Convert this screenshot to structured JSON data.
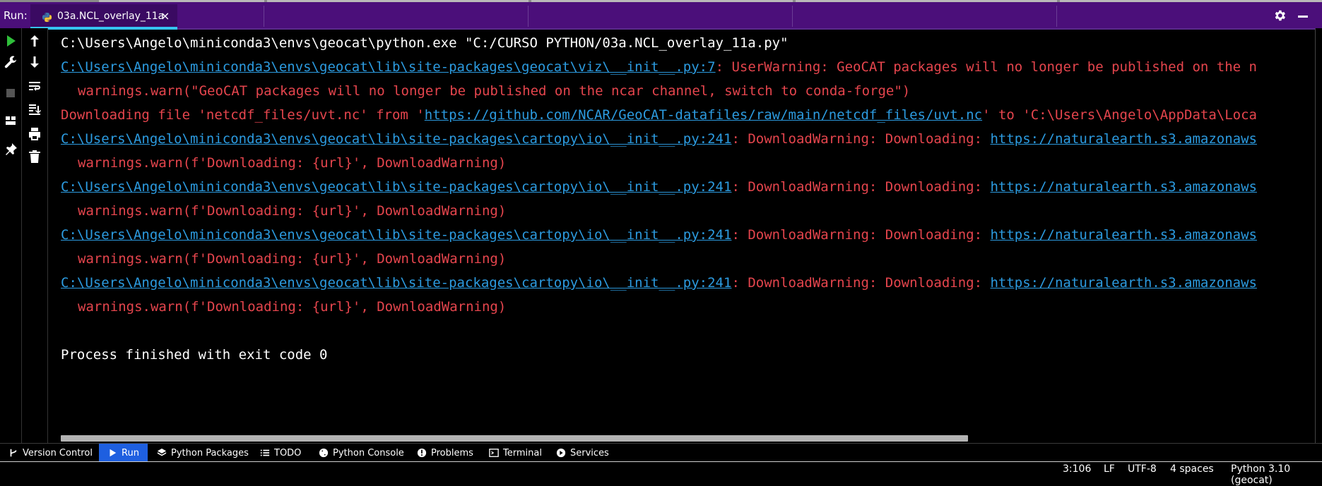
{
  "header": {
    "run_label": "Run:",
    "tab_label": "03a.NCL_overlay_11a",
    "tab_close": "×"
  },
  "console": {
    "lines": [
      {
        "segments": [
          {
            "text": "C:\\Users\\Angelo\\miniconda3\\envs\\geocat\\python.exe \"C:/CURSO PYTHON/03a.NCL_overlay_11a.py\"",
            "style": "w"
          }
        ]
      },
      {
        "segments": [
          {
            "text": "C:\\Users\\Angelo\\miniconda3\\envs\\geocat\\lib\\site-packages\\geocat\\viz\\__init__.py:7",
            "style": "lnk"
          },
          {
            "text": ": UserWarning: GeoCAT packages will no longer be published on the n",
            "style": "r"
          }
        ]
      },
      {
        "indent": true,
        "segments": [
          {
            "text": "warnings.warn(\"GeoCAT packages will no longer be published on the ncar channel, switch to conda-forge\")",
            "style": "r"
          }
        ]
      },
      {
        "segments": [
          {
            "text": "Downloading file 'netcdf_files/uvt.nc' from '",
            "style": "r"
          },
          {
            "text": "https://github.com/NCAR/GeoCAT-datafiles/raw/main/netcdf_files/uvt.nc",
            "style": "lnk"
          },
          {
            "text": "' to 'C:\\Users\\Angelo\\AppData\\Loca",
            "style": "r"
          }
        ]
      },
      {
        "segments": [
          {
            "text": "C:\\Users\\Angelo\\miniconda3\\envs\\geocat\\lib\\site-packages\\cartopy\\io\\__init__.py:241",
            "style": "lnk"
          },
          {
            "text": ": DownloadWarning: Downloading: ",
            "style": "r"
          },
          {
            "text": "https://naturalearth.s3.amazonaws",
            "style": "lnk"
          }
        ]
      },
      {
        "indent": true,
        "segments": [
          {
            "text": "warnings.warn(f'Downloading: {url}', DownloadWarning)",
            "style": "r"
          }
        ]
      },
      {
        "segments": [
          {
            "text": "C:\\Users\\Angelo\\miniconda3\\envs\\geocat\\lib\\site-packages\\cartopy\\io\\__init__.py:241",
            "style": "lnk"
          },
          {
            "text": ": DownloadWarning: Downloading: ",
            "style": "r"
          },
          {
            "text": "https://naturalearth.s3.amazonaws",
            "style": "lnk"
          }
        ]
      },
      {
        "indent": true,
        "segments": [
          {
            "text": "warnings.warn(f'Downloading: {url}', DownloadWarning)",
            "style": "r"
          }
        ]
      },
      {
        "segments": [
          {
            "text": "C:\\Users\\Angelo\\miniconda3\\envs\\geocat\\lib\\site-packages\\cartopy\\io\\__init__.py:241",
            "style": "lnk"
          },
          {
            "text": ": DownloadWarning: Downloading: ",
            "style": "r"
          },
          {
            "text": "https://naturalearth.s3.amazonaws",
            "style": "lnk"
          }
        ]
      },
      {
        "indent": true,
        "segments": [
          {
            "text": "warnings.warn(f'Downloading: {url}', DownloadWarning)",
            "style": "r"
          }
        ]
      },
      {
        "segments": [
          {
            "text": "C:\\Users\\Angelo\\miniconda3\\envs\\geocat\\lib\\site-packages\\cartopy\\io\\__init__.py:241",
            "style": "lnk"
          },
          {
            "text": ": DownloadWarning: Downloading: ",
            "style": "r"
          },
          {
            "text": "https://naturalearth.s3.amazonaws",
            "style": "lnk"
          }
        ]
      },
      {
        "indent": true,
        "segments": [
          {
            "text": "warnings.warn(f'Downloading: {url}', DownloadWarning)",
            "style": "r"
          }
        ]
      },
      {
        "segments": [
          {
            "text": "",
            "style": "w"
          }
        ]
      },
      {
        "segments": [
          {
            "text": "Process finished with exit code 0",
            "style": "w"
          }
        ]
      }
    ]
  },
  "bottom_tabs": [
    {
      "label": "Version Control",
      "icon": "branch-icon"
    },
    {
      "label": "Run",
      "icon": "play-icon",
      "active": true
    },
    {
      "label": "Python Packages",
      "icon": "layers-icon"
    },
    {
      "label": "TODO",
      "icon": "list-icon"
    },
    {
      "label": "Python Console",
      "icon": "python-icon"
    },
    {
      "label": "Problems",
      "icon": "alert-icon"
    },
    {
      "label": "Terminal",
      "icon": "terminal-icon"
    },
    {
      "label": "Services",
      "icon": "services-icon"
    }
  ],
  "status": {
    "position": "3:106",
    "line_sep": "LF",
    "encoding": "UTF-8",
    "indent": "4 spaces",
    "interpreter": "Python 3.10 (geocat)"
  },
  "colors": {
    "header_bg": "#4b0f7a",
    "accent_blue": "#36c3f3",
    "error_red": "#e5454d",
    "link_blue": "#2c9be0",
    "active_tab": "#1e5fe0"
  }
}
